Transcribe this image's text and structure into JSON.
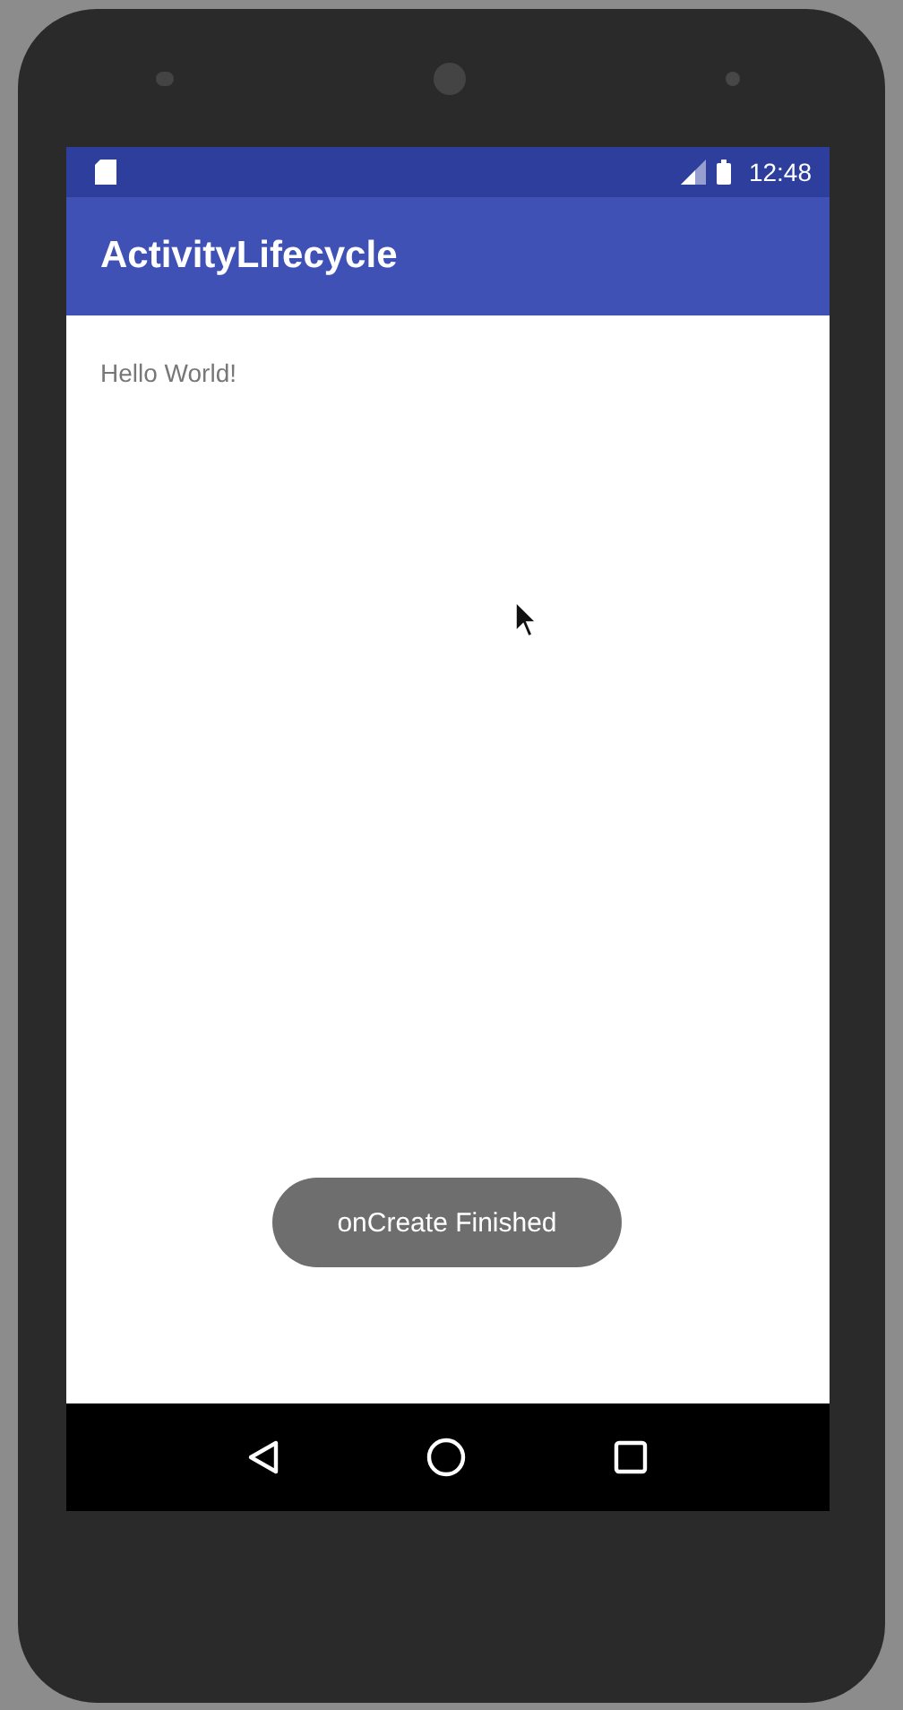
{
  "status_bar": {
    "time": "12:48"
  },
  "app_bar": {
    "title": "ActivityLifecycle"
  },
  "content": {
    "text": "Hello World!"
  },
  "toast": {
    "text": "onCreate Finished"
  }
}
